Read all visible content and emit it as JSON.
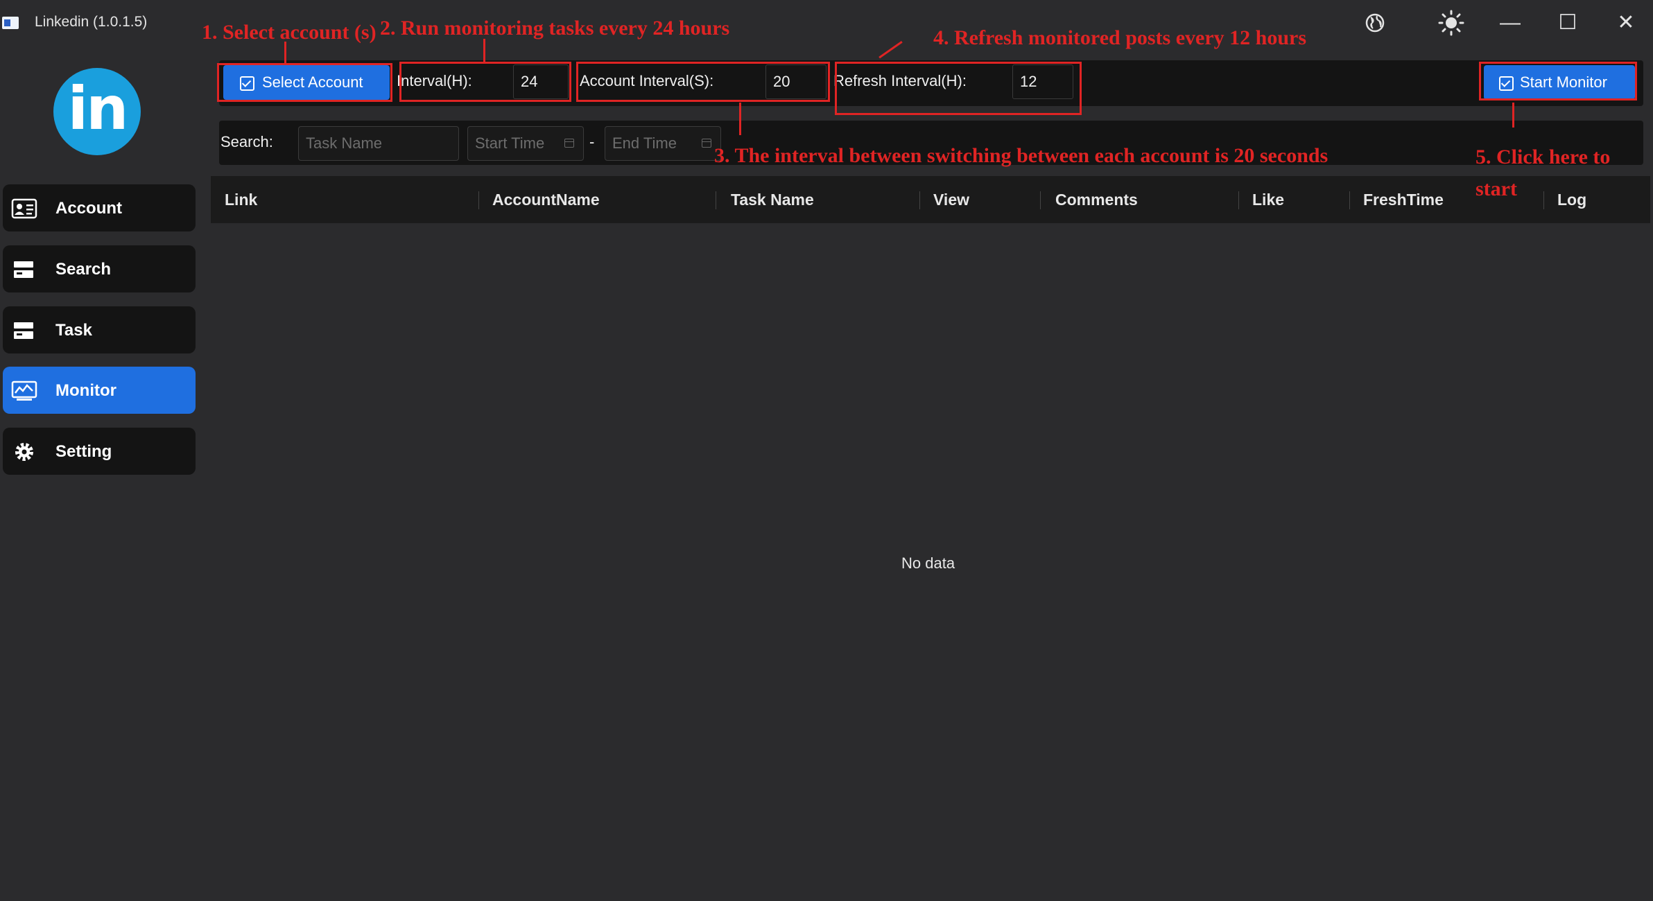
{
  "window": {
    "title": "Linkedin (1.0.1.5)",
    "minimize": "—",
    "maximize": "☐",
    "close": "✕"
  },
  "logo": {
    "text": "in",
    "color": "#1a9fdd"
  },
  "sidebar": {
    "items": [
      {
        "label": "Account",
        "icon": "account-card-icon",
        "active": false
      },
      {
        "label": "Search",
        "icon": "search-list-icon",
        "active": false
      },
      {
        "label": "Task",
        "icon": "task-list-icon",
        "active": false
      },
      {
        "label": "Monitor",
        "icon": "monitor-chart-icon",
        "active": true
      },
      {
        "label": "Setting",
        "icon": "gear-icon",
        "active": false
      }
    ]
  },
  "toolbar": {
    "select_account_label": "Select Account",
    "interval_label": "Interval(H):",
    "interval_value": "24",
    "account_interval_label": "Account Interval(S):",
    "account_interval_value": "20",
    "refresh_interval_label": "Refresh Interval(H):",
    "refresh_interval_value": "12",
    "start_monitor_label": "Start Monitor"
  },
  "search": {
    "label": "Search:",
    "task_name_placeholder": "Task Name",
    "start_time_placeholder": "Start Time",
    "dash": "-",
    "end_time_placeholder": "End Time"
  },
  "table": {
    "columns": [
      "Link",
      "AccountName",
      "Task Name",
      "View",
      "Comments",
      "Like",
      "FreshTime",
      "Log"
    ],
    "empty_text": "No data"
  },
  "annotations": {
    "step1": "1. Select account (s)",
    "step2": "2. Run monitoring tasks every 24 hours",
    "step3": "3. The interval between switching between each account is 20 seconds",
    "step4": "4. Refresh monitored posts every 12 hours",
    "step5_line1": "5. Click here to",
    "step5_line2": "start"
  },
  "colors": {
    "accent": "#1f6fe0",
    "annotation": "#e02424",
    "background": "#2b2b2d",
    "panel": "#141414"
  }
}
